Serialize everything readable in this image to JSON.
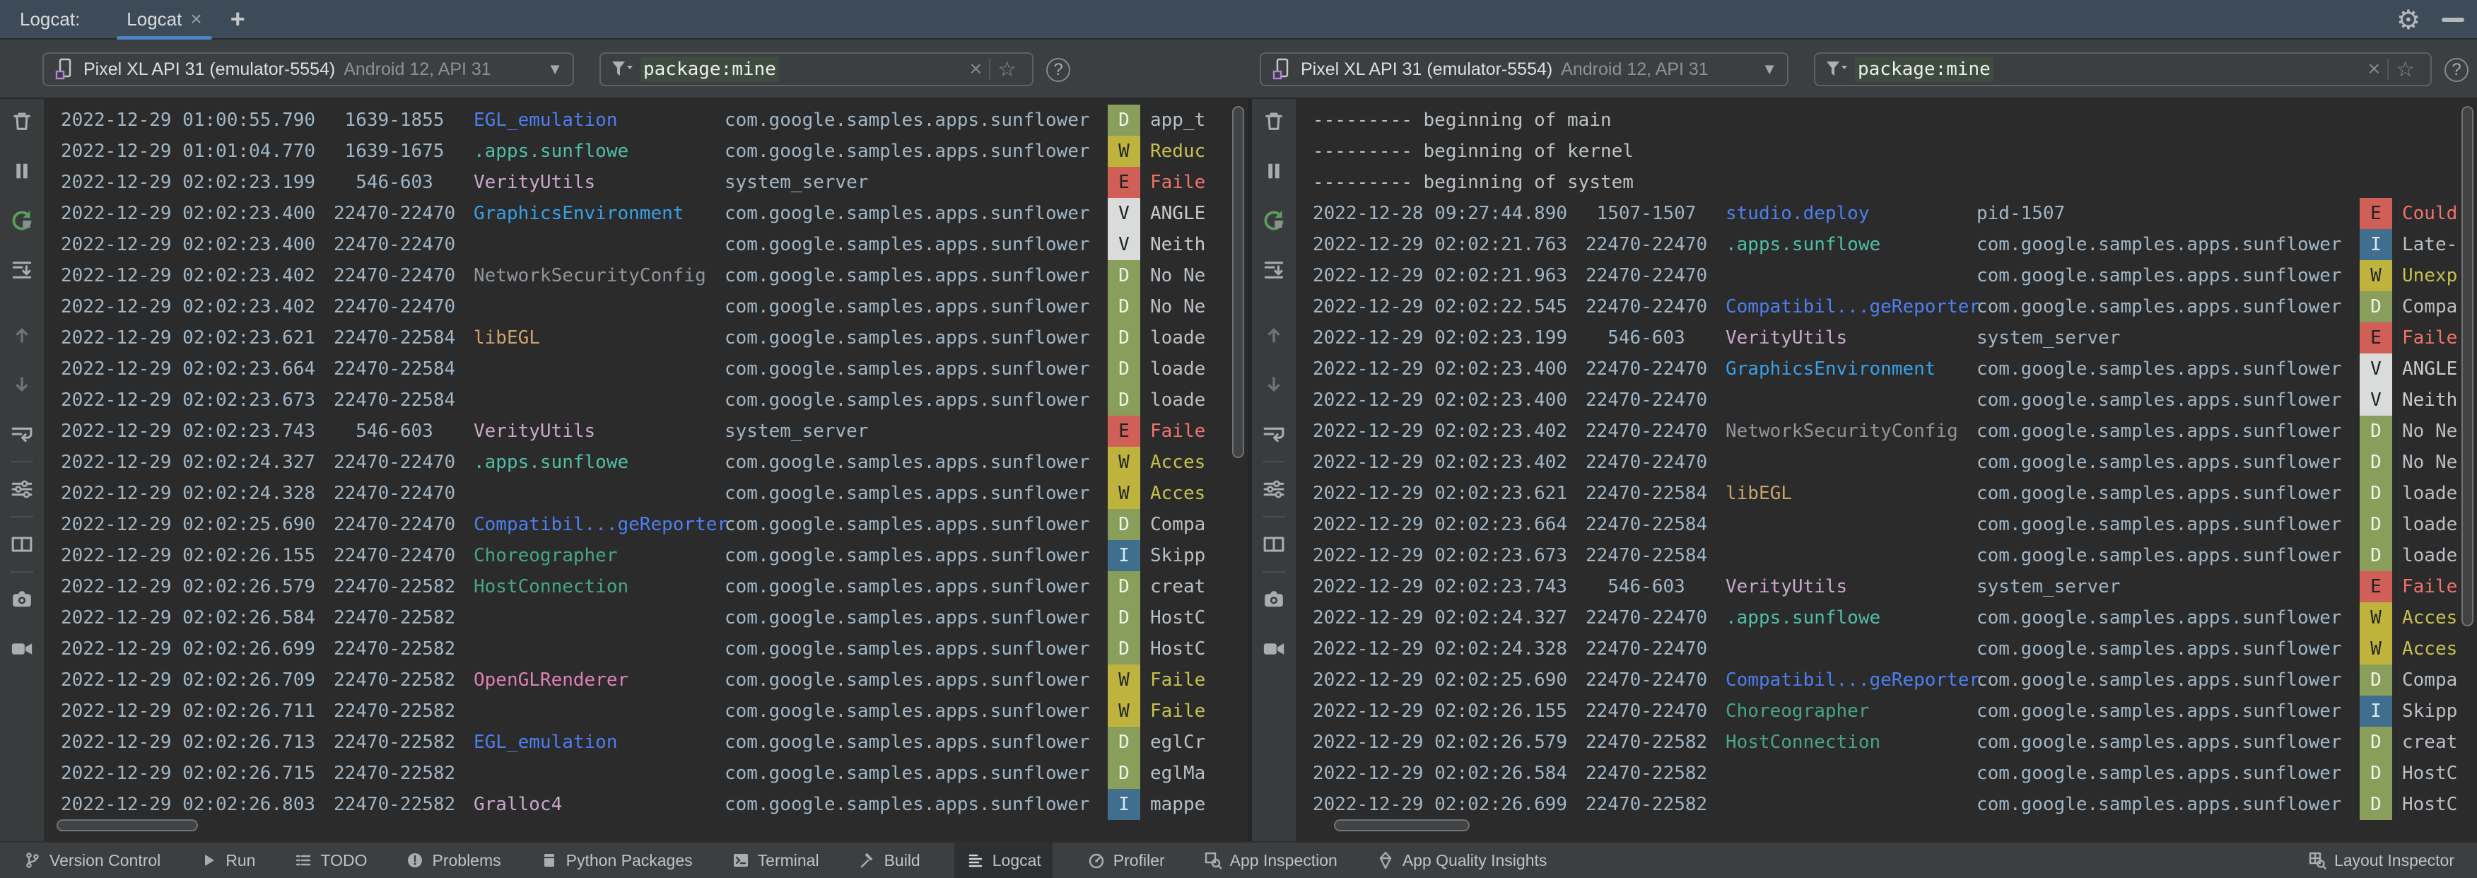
{
  "window": {
    "strip_label": "Logcat:",
    "tab_title": "Logcat",
    "tab_close": "×",
    "tab_add": "+",
    "gear": "⚙"
  },
  "header": {
    "help": "?",
    "clear": "×",
    "favorite": "☆"
  },
  "colors": {
    "accent_tab_underline": "#4A86C7",
    "filter_highlight_bg": "#3E4B3E",
    "levels": {
      "D": {
        "bg": "#8A9E5C",
        "fg": "#EFF3E4",
        "msg": "#B9BFC4"
      },
      "W": {
        "bg": "#BEB43D",
        "fg": "#222222",
        "msg": "#C6C04E"
      },
      "E": {
        "bg": "#D05F58",
        "fg": "#222222",
        "msg": "#F0736A"
      },
      "V": {
        "bg": "#DADBDB",
        "fg": "#222222",
        "msg": "#C8CCCF"
      },
      "I": {
        "bg": "#3F6E8E",
        "fg": "#DCE9F2",
        "msg": "#B9BFC4"
      }
    },
    "tags": {
      "blue": "#4D7FF0",
      "cyan": "#38A0E8",
      "teal": "#4FBFA6",
      "green": "#47A684",
      "lavender": "#CBA6CD",
      "pink": "#DF80B8",
      "gray": "#8F959B",
      "tan": "#CBA36D"
    }
  },
  "log_toolbar": [
    {
      "name": "clear-logcat-icon"
    },
    {
      "name": "pause-logcat-icon"
    },
    {
      "name": "restart-logcat-icon"
    },
    {
      "name": "scroll-to-end-icon"
    },
    {
      "name": "previous-occurrence-icon",
      "gap": true
    },
    {
      "name": "next-occurrence-icon"
    },
    {
      "name": "soft-wrap-icon"
    },
    {
      "name": "separator"
    },
    {
      "name": "configure-logcat-icon"
    },
    {
      "name": "separator"
    },
    {
      "name": "split-panels-icon"
    },
    {
      "name": "separator"
    },
    {
      "name": "screenshot-icon"
    },
    {
      "name": "screen-record-icon"
    }
  ],
  "panels": [
    {
      "device_name": "Pixel XL API 31 (emulator-5554)",
      "device_detail": "Android 12, API 31",
      "filter_value": "package:mine",
      "rows": [
        {
          "time": "2022-12-29 01:00:55.790",
          "pid": "1639-1855",
          "tag": "EGL_emulation",
          "tag_color": "blue",
          "pkg": "com.google.samples.apps.sunflower",
          "level": "D",
          "msg": "app_t"
        },
        {
          "time": "2022-12-29 01:01:04.770",
          "pid": "1639-1675",
          "tag": ".apps.sunflowe",
          "tag_color": "teal",
          "pkg": "com.google.samples.apps.sunflower",
          "level": "W",
          "msg": "Reduc"
        },
        {
          "time": "2022-12-29 02:02:23.199",
          "pid": "546-603",
          "tag": "VerityUtils",
          "tag_color": "lavender",
          "pkg": "system_server",
          "level": "E",
          "msg": "Faile"
        },
        {
          "time": "2022-12-29 02:02:23.400",
          "pid": "22470-22470",
          "tag": "GraphicsEnvironment",
          "tag_color": "cyan",
          "pkg": "com.google.samples.apps.sunflower",
          "level": "V",
          "msg": "ANGLE"
        },
        {
          "time": "2022-12-29 02:02:23.400",
          "pid": "22470-22470",
          "tag": "",
          "tag_color": "",
          "pkg": "com.google.samples.apps.sunflower",
          "level": "V",
          "msg": "Neith"
        },
        {
          "time": "2022-12-29 02:02:23.402",
          "pid": "22470-22470",
          "tag": "NetworkSecurityConfig",
          "tag_color": "gray",
          "pkg": "com.google.samples.apps.sunflower",
          "level": "D",
          "msg": "No Ne"
        },
        {
          "time": "2022-12-29 02:02:23.402",
          "pid": "22470-22470",
          "tag": "",
          "tag_color": "",
          "pkg": "com.google.samples.apps.sunflower",
          "level": "D",
          "msg": "No Ne"
        },
        {
          "time": "2022-12-29 02:02:23.621",
          "pid": "22470-22584",
          "tag": "libEGL",
          "tag_color": "tan",
          "pkg": "com.google.samples.apps.sunflower",
          "level": "D",
          "msg": "loade"
        },
        {
          "time": "2022-12-29 02:02:23.664",
          "pid": "22470-22584",
          "tag": "",
          "tag_color": "",
          "pkg": "com.google.samples.apps.sunflower",
          "level": "D",
          "msg": "loade"
        },
        {
          "time": "2022-12-29 02:02:23.673",
          "pid": "22470-22584",
          "tag": "",
          "tag_color": "",
          "pkg": "com.google.samples.apps.sunflower",
          "level": "D",
          "msg": "loade"
        },
        {
          "time": "2022-12-29 02:02:23.743",
          "pid": "546-603",
          "tag": "VerityUtils",
          "tag_color": "lavender",
          "pkg": "system_server",
          "level": "E",
          "msg": "Faile"
        },
        {
          "time": "2022-12-29 02:02:24.327",
          "pid": "22470-22470",
          "tag": ".apps.sunflowe",
          "tag_color": "teal",
          "pkg": "com.google.samples.apps.sunflower",
          "level": "W",
          "msg": "Acces"
        },
        {
          "time": "2022-12-29 02:02:24.328",
          "pid": "22470-22470",
          "tag": "",
          "tag_color": "",
          "pkg": "com.google.samples.apps.sunflower",
          "level": "W",
          "msg": "Acces"
        },
        {
          "time": "2022-12-29 02:02:25.690",
          "pid": "22470-22470",
          "tag": "Compatibil...geReporter",
          "tag_color": "blue",
          "pkg": "com.google.samples.apps.sunflower",
          "level": "D",
          "msg": "Compa"
        },
        {
          "time": "2022-12-29 02:02:26.155",
          "pid": "22470-22470",
          "tag": "Choreographer",
          "tag_color": "green",
          "pkg": "com.google.samples.apps.sunflower",
          "level": "I",
          "msg": "Skipp"
        },
        {
          "time": "2022-12-29 02:02:26.579",
          "pid": "22470-22582",
          "tag": "HostConnection",
          "tag_color": "green",
          "pkg": "com.google.samples.apps.sunflower",
          "level": "D",
          "msg": "creat"
        },
        {
          "time": "2022-12-29 02:02:26.584",
          "pid": "22470-22582",
          "tag": "",
          "tag_color": "",
          "pkg": "com.google.samples.apps.sunflower",
          "level": "D",
          "msg": "HostC"
        },
        {
          "time": "2022-12-29 02:02:26.699",
          "pid": "22470-22582",
          "tag": "",
          "tag_color": "",
          "pkg": "com.google.samples.apps.sunflower",
          "level": "D",
          "msg": "HostC"
        },
        {
          "time": "2022-12-29 02:02:26.709",
          "pid": "22470-22582",
          "tag": "OpenGLRenderer",
          "tag_color": "pink",
          "pkg": "com.google.samples.apps.sunflower",
          "level": "W",
          "msg": "Faile"
        },
        {
          "time": "2022-12-29 02:02:26.711",
          "pid": "22470-22582",
          "tag": "",
          "tag_color": "",
          "pkg": "com.google.samples.apps.sunflower",
          "level": "W",
          "msg": "Faile"
        },
        {
          "time": "2022-12-29 02:02:26.713",
          "pid": "22470-22582",
          "tag": "EGL_emulation",
          "tag_color": "blue",
          "pkg": "com.google.samples.apps.sunflower",
          "level": "D",
          "msg": "eglCr"
        },
        {
          "time": "2022-12-29 02:02:26.715",
          "pid": "22470-22582",
          "tag": "",
          "tag_color": "",
          "pkg": "com.google.samples.apps.sunflower",
          "level": "D",
          "msg": "eglMa"
        },
        {
          "time": "2022-12-29 02:02:26.803",
          "pid": "22470-22582",
          "tag": "Gralloc4",
          "tag_color": "lavender",
          "pkg": "com.google.samples.apps.sunflower",
          "level": "I",
          "msg": "mappe"
        }
      ]
    },
    {
      "device_name": "Pixel XL API 31 (emulator-5554)",
      "device_detail": "Android 12, API 31",
      "filter_value": "package:mine",
      "rows": [
        {
          "banner": "--------- beginning of main"
        },
        {
          "banner": "--------- beginning of kernel"
        },
        {
          "banner": "--------- beginning of system"
        },
        {
          "time": "2022-12-28 09:27:44.890",
          "pid": "1507-1507",
          "tag": "studio.deploy",
          "tag_color": "blue",
          "pkg": "pid-1507",
          "level": "E",
          "msg": "Could"
        },
        {
          "time": "2022-12-29 02:02:21.763",
          "pid": "22470-22470",
          "tag": ".apps.sunflowe",
          "tag_color": "teal",
          "pkg": "com.google.samples.apps.sunflower",
          "level": "I",
          "msg": "Late-"
        },
        {
          "time": "2022-12-29 02:02:21.963",
          "pid": "22470-22470",
          "tag": "",
          "tag_color": "",
          "pkg": "com.google.samples.apps.sunflower",
          "level": "W",
          "msg": "Unexp"
        },
        {
          "time": "2022-12-29 02:02:22.545",
          "pid": "22470-22470",
          "tag": "Compatibil...geReporter",
          "tag_color": "blue",
          "pkg": "com.google.samples.apps.sunflower",
          "level": "D",
          "msg": "Compa"
        },
        {
          "time": "2022-12-29 02:02:23.199",
          "pid": "546-603",
          "tag": "VerityUtils",
          "tag_color": "lavender",
          "pkg": "system_server",
          "level": "E",
          "msg": "Faile"
        },
        {
          "time": "2022-12-29 02:02:23.400",
          "pid": "22470-22470",
          "tag": "GraphicsEnvironment",
          "tag_color": "cyan",
          "pkg": "com.google.samples.apps.sunflower",
          "level": "V",
          "msg": "ANGLE"
        },
        {
          "time": "2022-12-29 02:02:23.400",
          "pid": "22470-22470",
          "tag": "",
          "tag_color": "",
          "pkg": "com.google.samples.apps.sunflower",
          "level": "V",
          "msg": "Neith"
        },
        {
          "time": "2022-12-29 02:02:23.402",
          "pid": "22470-22470",
          "tag": "NetworkSecurityConfig",
          "tag_color": "gray",
          "pkg": "com.google.samples.apps.sunflower",
          "level": "D",
          "msg": "No Ne"
        },
        {
          "time": "2022-12-29 02:02:23.402",
          "pid": "22470-22470",
          "tag": "",
          "tag_color": "",
          "pkg": "com.google.samples.apps.sunflower",
          "level": "D",
          "msg": "No Ne"
        },
        {
          "time": "2022-12-29 02:02:23.621",
          "pid": "22470-22584",
          "tag": "libEGL",
          "tag_color": "tan",
          "pkg": "com.google.samples.apps.sunflower",
          "level": "D",
          "msg": "loade"
        },
        {
          "time": "2022-12-29 02:02:23.664",
          "pid": "22470-22584",
          "tag": "",
          "tag_color": "",
          "pkg": "com.google.samples.apps.sunflower",
          "level": "D",
          "msg": "loade"
        },
        {
          "time": "2022-12-29 02:02:23.673",
          "pid": "22470-22584",
          "tag": "",
          "tag_color": "",
          "pkg": "com.google.samples.apps.sunflower",
          "level": "D",
          "msg": "loade"
        },
        {
          "time": "2022-12-29 02:02:23.743",
          "pid": "546-603",
          "tag": "VerityUtils",
          "tag_color": "lavender",
          "pkg": "system_server",
          "level": "E",
          "msg": "Faile"
        },
        {
          "time": "2022-12-29 02:02:24.327",
          "pid": "22470-22470",
          "tag": ".apps.sunflowe",
          "tag_color": "teal",
          "pkg": "com.google.samples.apps.sunflower",
          "level": "W",
          "msg": "Acces"
        },
        {
          "time": "2022-12-29 02:02:24.328",
          "pid": "22470-22470",
          "tag": "",
          "tag_color": "",
          "pkg": "com.google.samples.apps.sunflower",
          "level": "W",
          "msg": "Acces"
        },
        {
          "time": "2022-12-29 02:02:25.690",
          "pid": "22470-22470",
          "tag": "Compatibil...geReporter",
          "tag_color": "blue",
          "pkg": "com.google.samples.apps.sunflower",
          "level": "D",
          "msg": "Compa"
        },
        {
          "time": "2022-12-29 02:02:26.155",
          "pid": "22470-22470",
          "tag": "Choreographer",
          "tag_color": "green",
          "pkg": "com.google.samples.apps.sunflower",
          "level": "I",
          "msg": "Skipp"
        },
        {
          "time": "2022-12-29 02:02:26.579",
          "pid": "22470-22582",
          "tag": "HostConnection",
          "tag_color": "green",
          "pkg": "com.google.samples.apps.sunflower",
          "level": "D",
          "msg": "creat"
        },
        {
          "time": "2022-12-29 02:02:26.584",
          "pid": "22470-22582",
          "tag": "",
          "tag_color": "",
          "pkg": "com.google.samples.apps.sunflower",
          "level": "D",
          "msg": "HostC"
        },
        {
          "time": "2022-12-29 02:02:26.699",
          "pid": "22470-22582",
          "tag": "",
          "tag_color": "",
          "pkg": "com.google.samples.apps.sunflower",
          "level": "D",
          "msg": "HostC"
        }
      ]
    }
  ],
  "statusbar": {
    "left": [
      {
        "icon": "version-control-icon",
        "label": "Version Control"
      },
      {
        "icon": "run-icon",
        "label": "Run"
      },
      {
        "icon": "todo-icon",
        "label": "TODO"
      },
      {
        "icon": "problems-icon",
        "label": "Problems"
      },
      {
        "icon": "python-packages-icon",
        "label": "Python Packages"
      },
      {
        "icon": "terminal-icon",
        "label": "Terminal"
      },
      {
        "icon": "build-icon",
        "label": "Build"
      },
      {
        "icon": "logcat-icon",
        "label": "Logcat",
        "active": true
      },
      {
        "icon": "profiler-icon",
        "label": "Profiler"
      },
      {
        "icon": "app-inspection-icon",
        "label": "App Inspection"
      },
      {
        "icon": "app-quality-insights-icon",
        "label": "App Quality Insights"
      }
    ],
    "right": [
      {
        "icon": "layout-inspector-icon",
        "label": "Layout Inspector"
      }
    ]
  }
}
